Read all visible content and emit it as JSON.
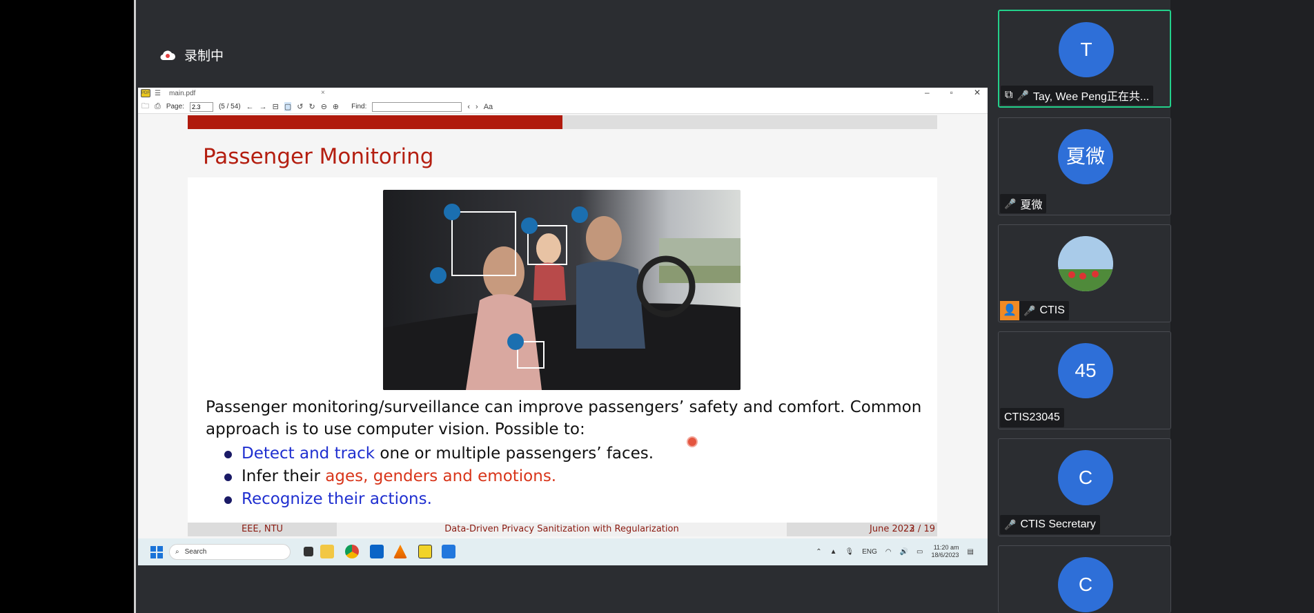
{
  "recording": {
    "label": "录制中"
  },
  "pdf_viewer": {
    "tab_title": "main.pdf",
    "page_label": "Page:",
    "page_value": "2.3",
    "page_count": "(5 / 54)",
    "find_label": "Find:"
  },
  "slide": {
    "title": "Passenger Monitoring",
    "paragraph": "Passenger monitoring/surveillance can improve passengers’ safety and comfort. Common approach is to use computer vision. Possible to:",
    "bullets": [
      {
        "highlight": "Detect and track",
        "rest": " one or multiple passengers’ faces."
      },
      {
        "prefix": "Infer their ",
        "highlight": "ages, genders and emotions."
      },
      {
        "highlight": "Recognize their actions."
      }
    ],
    "footer": {
      "left": "EEE, NTU",
      "center": "Data-Driven Privacy Sanitization with Regularization",
      "date": "June 2023",
      "page": "2 / 19"
    },
    "progress_fraction": 0.5
  },
  "taskbar": {
    "search_placeholder": "Search",
    "lang": "ENG",
    "time": "11:20 am",
    "date": "18/6/2023"
  },
  "participants": [
    {
      "initial": "T",
      "name": "Tay, Wee Peng正在共...",
      "mic": "on",
      "sharing": true
    },
    {
      "initial": "夏微",
      "name": "夏微",
      "mic": "muted"
    },
    {
      "initial": "",
      "name": "CTIS",
      "mic": "muted",
      "photo": true
    },
    {
      "initial": "45",
      "name": "CTIS23045",
      "mic": "none"
    },
    {
      "initial": "C",
      "name": "CTIS Secretary",
      "mic": "muted"
    },
    {
      "initial": "C",
      "name": "",
      "mic": "none"
    }
  ],
  "colors": {
    "accent_red": "#b41e10",
    "avatar_blue": "#2e6fd8",
    "active_border": "#23d18b"
  }
}
